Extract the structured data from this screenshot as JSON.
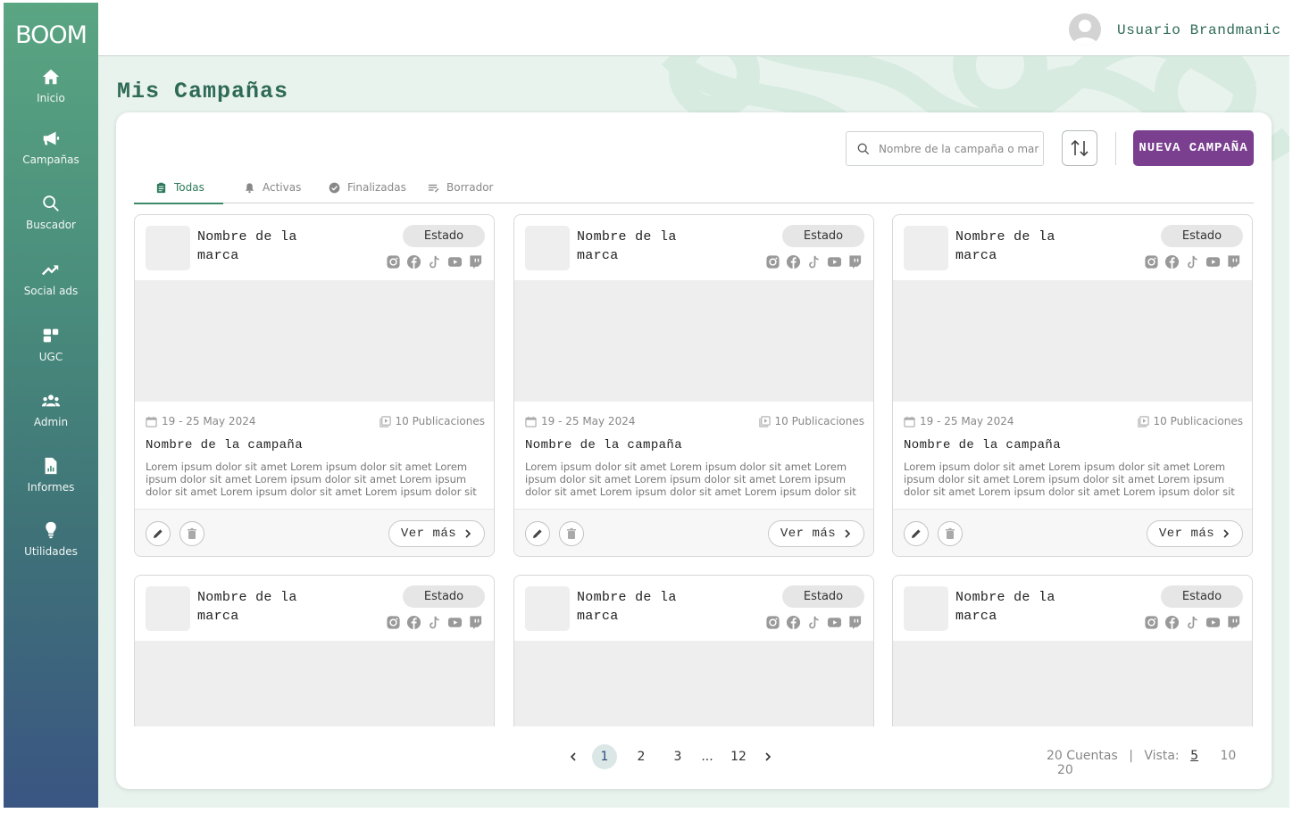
{
  "app": {
    "logo_text": "BOOM"
  },
  "sidebar": {
    "items": [
      {
        "label": "Inicio",
        "icon": "home-icon"
      },
      {
        "label": "Campañas",
        "icon": "megaphone-icon"
      },
      {
        "label": "Buscador",
        "icon": "search-icon"
      },
      {
        "label": "Social ads",
        "icon": "trending-up-icon"
      },
      {
        "label": "UGC",
        "icon": "dashboard-icon"
      },
      {
        "label": "Admin",
        "icon": "group-icon"
      },
      {
        "label": "Informes",
        "icon": "report-icon"
      },
      {
        "label": "Utilidades",
        "icon": "lightbulb-icon"
      }
    ]
  },
  "header": {
    "user_name": "Usuario Brandmanic"
  },
  "page": {
    "title": "Mis Campañas"
  },
  "toolbar": {
    "search_placeholder": "Nombre de la campaña o marca",
    "new_campaign_label": "NUEVA CAMPAÑA"
  },
  "tabs": [
    {
      "label": "Todas",
      "active": true
    },
    {
      "label": "Activas",
      "active": false
    },
    {
      "label": "Finalizadas",
      "active": false
    },
    {
      "label": "Borrador",
      "active": false
    }
  ],
  "cards": [
    {
      "brand": "Nombre de la marca",
      "status": "Estado",
      "date": "19 - 25 May 2024",
      "publications": "10 Publicaciones",
      "campaign": "Nombre de la campaña",
      "description": "Lorem ipsum dolor sit amet Lorem ipsum dolor sit amet Lorem ipsum dolor sit amet Lorem ipsum dolor sit amet Lorem ipsum dolor sit amet Lorem ipsum dolor sit amet Lorem ipsum dolor sit amet Lorem ipsum...",
      "more": "Ver más"
    },
    {
      "brand": "Nombre de la marca",
      "status": "Estado",
      "date": "19 - 25 May 2024",
      "publications": "10 Publicaciones",
      "campaign": "Nombre de la campaña",
      "description": "Lorem ipsum dolor sit amet Lorem ipsum dolor sit amet Lorem ipsum dolor sit amet Lorem ipsum dolor sit amet Lorem ipsum dolor sit amet Lorem ipsum dolor sit amet Lorem ipsum dolor sit amet Lorem ipsum...",
      "more": "Ver más"
    },
    {
      "brand": "Nombre de la marca",
      "status": "Estado",
      "date": "19 - 25 May 2024",
      "publications": "10 Publicaciones",
      "campaign": "Nombre de la campaña",
      "description": "Lorem ipsum dolor sit amet Lorem ipsum dolor sit amet Lorem ipsum dolor sit amet Lorem ipsum dolor sit amet Lorem ipsum dolor sit amet Lorem ipsum dolor sit amet Lorem ipsum dolor sit amet Lorem ipsum...",
      "more": "Ver más"
    },
    {
      "brand": "Nombre de la marca",
      "status": "Estado"
    },
    {
      "brand": "Nombre de la marca",
      "status": "Estado"
    },
    {
      "brand": "Nombre de la marca",
      "status": "Estado"
    }
  ],
  "pagination": {
    "prev_icon": "chevron-left-icon",
    "next_icon": "chevron-right-icon",
    "pages": [
      "1",
      "2",
      "3",
      "...",
      "12"
    ],
    "current": "1",
    "total_label": "20 Cuentas",
    "separator": "|",
    "view_label": "Vista:",
    "view_options": [
      "5",
      "10",
      "20"
    ],
    "view_selected": "5"
  },
  "colors": {
    "accent_green": "#2f6a57",
    "primary_purple": "#7a3f8f",
    "sidebar_top": "#5aa582",
    "sidebar_bottom": "#3a5582"
  }
}
